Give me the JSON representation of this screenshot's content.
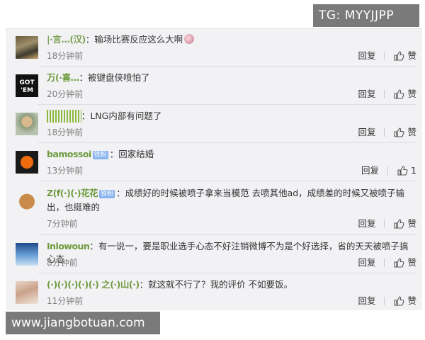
{
  "watermarks": {
    "top": "TG: MYYJJPP",
    "bottom": "www.jiangbotuan.com"
  },
  "comments": [
    {
      "username": "|·言…(汉)",
      "text": "输场比赛反应这么大啊",
      "time": "18分钟前",
      "reply": "回复",
      "like": "赞"
    },
    {
      "username": "万(·喜…",
      "text": "被键盘侠喷怕了",
      "time": "20分钟前",
      "reply": "回复",
      "like": "赞"
    },
    {
      "username": "||||||||||||",
      "text": "LNG内部有问题了",
      "time": "18分钟前",
      "reply": "回复",
      "like": "赞"
    },
    {
      "username": "bamossoi",
      "badge": "铁粉",
      "text": "回家结婚",
      "time": "13分钟前",
      "reply": "回复",
      "like": "1"
    },
    {
      "username": "Z(f(·)(·)花花",
      "badge": "铁粉",
      "text": "成绩好的时候被喷子拿来当模范 去喷其他ad，成绩差的时候又被喷子输出，也挺难的",
      "time": "7分钟前",
      "reply": "回复",
      "like": "赞"
    },
    {
      "username": "Inlowoun",
      "text": "有一说一，要是职业选手心态不好注销微博不为是个好选择，省的天天被喷子搞心态",
      "time": "8分钟前",
      "reply": "回复",
      "like": "赞"
    },
    {
      "username": "(·)(·)(·)(·)(·) 之(·)山(·)",
      "text": "就这就不行了？我的评价 不如要饭。",
      "time": "11分钟前",
      "reply": "回复",
      "like": "赞"
    }
  ]
}
